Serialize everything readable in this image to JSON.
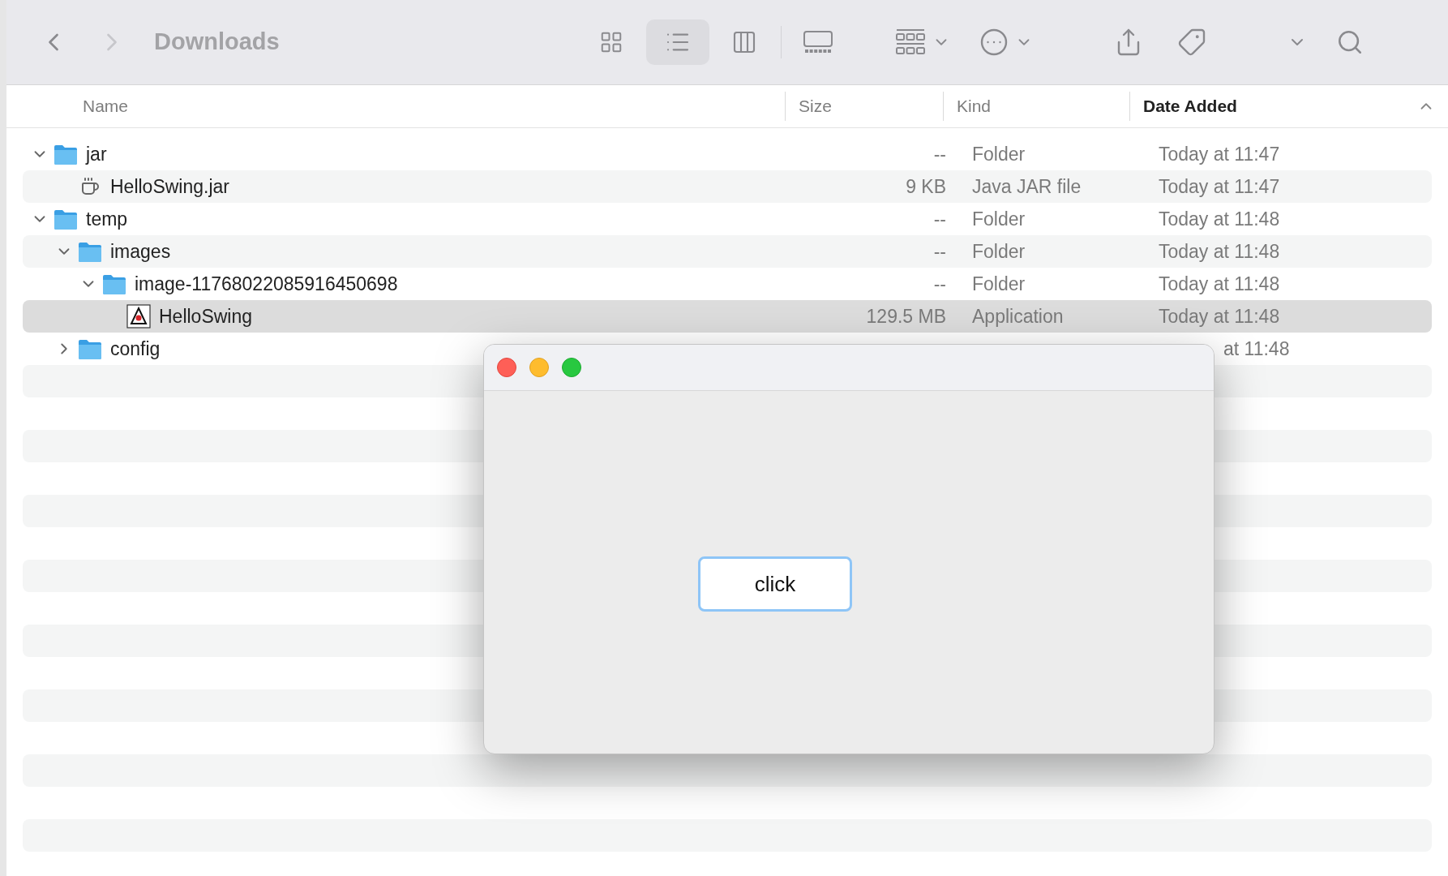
{
  "toolbar": {
    "title": "Downloads",
    "view_modes": [
      {
        "kind": "icons",
        "selected": false
      },
      {
        "kind": "list",
        "selected": true
      },
      {
        "kind": "columns",
        "selected": false
      },
      {
        "kind": "gallery",
        "selected": false
      }
    ]
  },
  "columns": [
    {
      "label": "Name",
      "sorted": false
    },
    {
      "label": "Size",
      "sorted": false
    },
    {
      "label": "Kind",
      "sorted": false
    },
    {
      "label": "Date Added",
      "sorted": true
    }
  ],
  "rows": [
    {
      "kind": "folder",
      "name": "jar",
      "size": "--",
      "type": "Folder",
      "date": "Today at 11:47",
      "expanded": true,
      "selected": false,
      "children": [
        {
          "kind": "jar",
          "name": "HelloSwing.jar",
          "size": "9 KB",
          "type": "Java JAR file",
          "date": "Today at 11:47",
          "selected": false
        }
      ]
    },
    {
      "kind": "folder",
      "name": "temp",
      "size": "--",
      "type": "Folder",
      "date": "Today at 11:48",
      "expanded": true,
      "selected": false,
      "children": [
        {
          "kind": "folder",
          "name": "images",
          "size": "--",
          "type": "Folder",
          "date": "Today at 11:48",
          "expanded": true,
          "selected": false,
          "children": [
            {
              "kind": "folder",
              "name": "image-11768022085916450698",
              "size": "--",
              "type": "Folder",
              "date": "Today at 11:48",
              "expanded": true,
              "selected": false,
              "children": [
                {
                  "kind": "app",
                  "name": "HelloSwing",
                  "size": "129.5 MB",
                  "type": "Application",
                  "date": "Today at 11:48",
                  "selected": true
                }
              ]
            }
          ]
        },
        {
          "kind": "folder",
          "name": "config",
          "date": "at 11:48",
          "expanded": false,
          "selected": false
        }
      ]
    }
  ],
  "dialog": {
    "button": "click"
  }
}
